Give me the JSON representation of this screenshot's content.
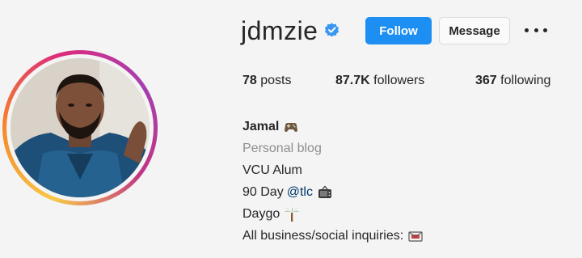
{
  "profile": {
    "username": "jdmzie",
    "verified": true,
    "follow_label": "Follow",
    "message_label": "Message"
  },
  "stats": {
    "posts_count": "78",
    "posts_label": "posts",
    "followers_count": "87.7K",
    "followers_label": "followers",
    "following_count": "367",
    "following_label": "following"
  },
  "bio": {
    "name": "Jamal",
    "category": "Personal blog",
    "line1": "VCU Alum",
    "line2_prefix": "90 Day",
    "line2_mention": "@tlc",
    "line3": "Daygo",
    "line4": "All business/social inquiries:"
  },
  "icons": {
    "name_emoji": "game-controller-icon",
    "tlc_emoji": "tv-icon",
    "daygo_emoji": "palm-tree-icon",
    "inquiries_emoji": "envelope-icon"
  },
  "colors": {
    "follow_button": "#1d8ff2",
    "verified_badge": "#3897f0",
    "mention_link": "#00376b",
    "category_text": "#8e8e8e"
  }
}
